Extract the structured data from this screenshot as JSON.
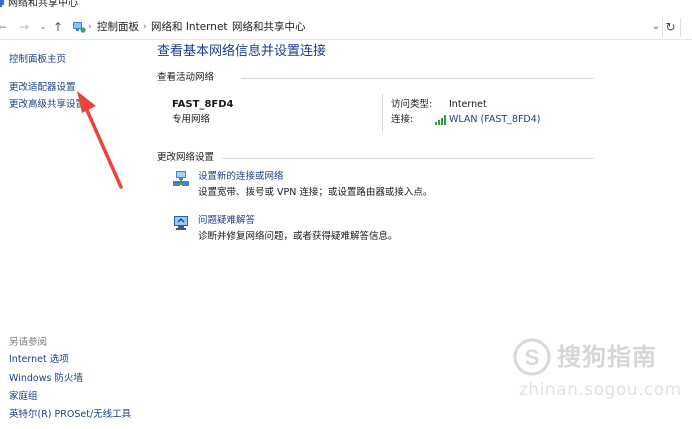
{
  "window": {
    "title": "网络和共享中心"
  },
  "address_bar": {
    "crumbs": [
      "控制面板",
      "网络和 Internet",
      "网络和共享中心"
    ]
  },
  "left_pane": {
    "links": [
      "控制面板主页",
      "更改适配器设置",
      "更改高级共享设置"
    ],
    "see_also_heading": "另请参阅",
    "see_also_links": [
      "Internet 选项",
      "Windows 防火墙",
      "家庭组",
      "英特尔(R) PROSet/无线工具"
    ]
  },
  "main": {
    "title": "查看基本网络信息并设置连接",
    "active_networks_heading": "查看活动网络",
    "network": {
      "name": "FAST_8FD4",
      "type": "专用网络",
      "access_type_label": "访问类型:",
      "access_type_value": "Internet",
      "connections_label": "连接:",
      "connection_value": "WLAN (FAST_8FD4)"
    },
    "change_settings_heading": "更改网络设置",
    "tasks": [
      {
        "link": "设置新的连接或网络",
        "desc": "设置宽带、拨号或 VPN 连接；或设置路由器或接入点。",
        "icon": "network-setup-icon"
      },
      {
        "link": "问题疑难解答",
        "desc": "诊断并修复网络问题，或者获得疑难解答信息。",
        "icon": "troubleshoot-icon"
      }
    ]
  },
  "annotation": {
    "color": "#e8453c"
  },
  "watermark": {
    "text": "搜狗指南",
    "url": "zhinan.sogou.com"
  }
}
